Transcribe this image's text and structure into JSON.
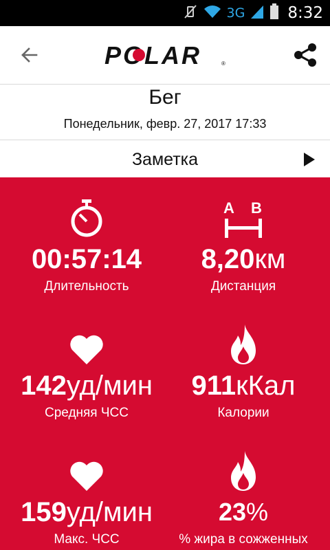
{
  "status_bar": {
    "network": "3G",
    "time": "8:32"
  },
  "app_bar": {
    "logo_text": "POLAR"
  },
  "activity": {
    "title": "Бег",
    "datetime": "Понедельник, февр. 27, 2017 17:33"
  },
  "note": {
    "label": "Заметка"
  },
  "stats": [
    {
      "icon": "stopwatch-icon",
      "value": "00:57:14",
      "unit": "",
      "label": "Длительность"
    },
    {
      "icon": "distance-ab-icon",
      "value": "8,20",
      "unit": "км",
      "label": "Дистанция",
      "icon_letters": [
        "A",
        "B"
      ]
    },
    {
      "icon": "heart-icon",
      "value": "142",
      "unit": "уд/мин",
      "label": "Средняя ЧСС"
    },
    {
      "icon": "flame-icon",
      "value": "911",
      "unit": "кКал",
      "label": "Калории"
    },
    {
      "icon": "heart-icon",
      "value": "159",
      "unit": "уд/мин",
      "label": "Макс. ЧСС"
    },
    {
      "icon": "flame-icon",
      "value": "23",
      "unit": "%",
      "label": "% жира в сожженных"
    }
  ],
  "colors": {
    "accent": "#d50b31",
    "status_bar": "#000000",
    "network_icon": "#2fa8e6"
  }
}
